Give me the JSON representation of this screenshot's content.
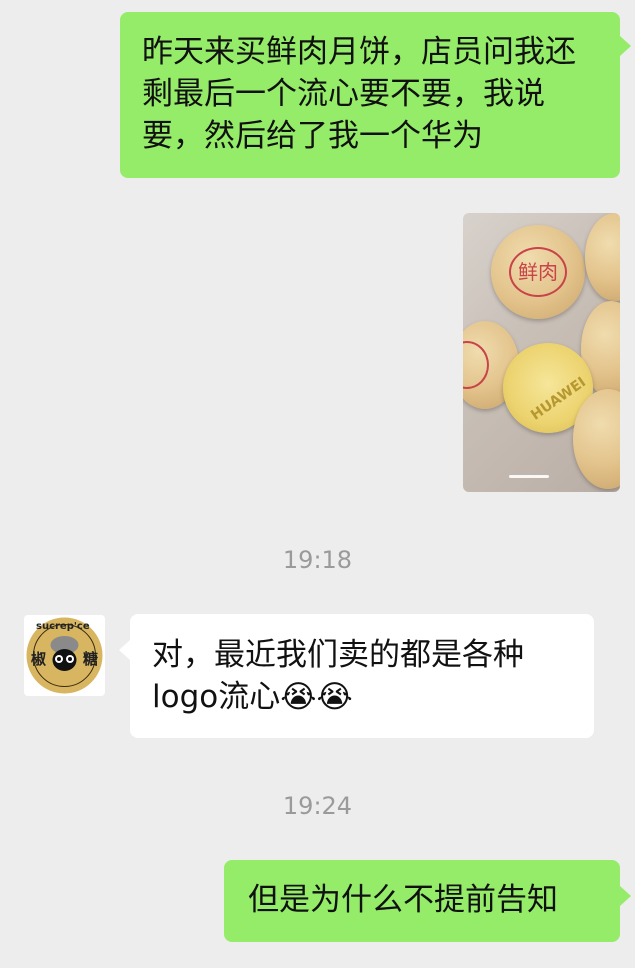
{
  "messages": {
    "m1": "昨天来买鲜肉月饼，店员问我还剩最后一个流心要不要，我说要，然后给了我一个华为",
    "m2": "对，最近我们卖的都是各种logo流心",
    "m2_emoji": "😭😭",
    "m3": "但是为什么不提前告知"
  },
  "timestamps": {
    "t1": "19:18",
    "t2": "19:24"
  },
  "photo": {
    "stamp_text": "鲜肉",
    "cake_text": "HUAWEI"
  },
  "avatar": {
    "brand_text": "sucrep'ce",
    "left_char": "椒",
    "right_char": "糖"
  },
  "colors": {
    "sent_bubble": "#95ec69",
    "received_bubble": "#ffffff",
    "background": "#ededed",
    "timestamp": "#9a9a9a"
  }
}
